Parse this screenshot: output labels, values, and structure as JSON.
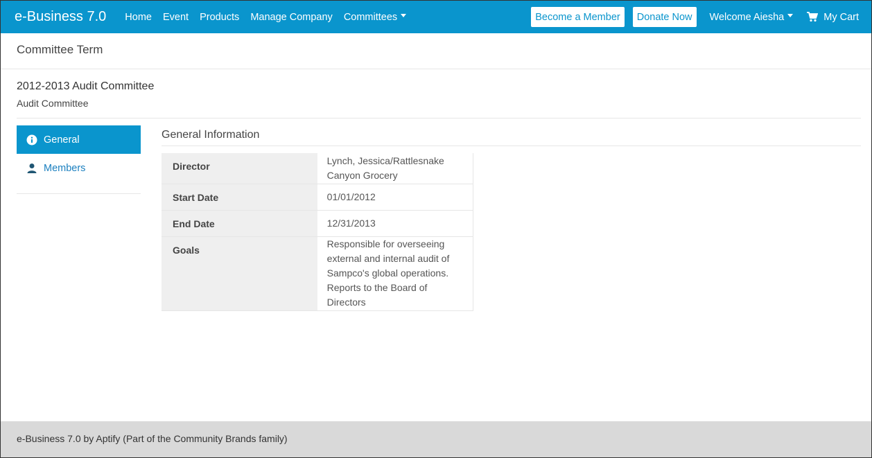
{
  "navbar": {
    "brand": "e-Business 7.0",
    "links": [
      "Home",
      "Event",
      "Products",
      "Manage Company",
      "Committees"
    ],
    "become_member": "Become a Member",
    "donate_now": "Donate Now",
    "welcome": "Welcome Aiesha",
    "cart": "My Cart",
    "color": "#0a95cd"
  },
  "page": {
    "title": "Committee Term"
  },
  "term": {
    "title": "2012-2013 Audit Committee",
    "subtitle": "Audit Committee"
  },
  "side_nav": {
    "general": "General",
    "members": "Members"
  },
  "general_info": {
    "title": "General Information",
    "rows": [
      {
        "label": "Director",
        "value": "Lynch, Jessica/Rattlesnake Canyon Grocery"
      },
      {
        "label": "Start Date",
        "value": "01/01/2012"
      },
      {
        "label": "End Date",
        "value": "12/31/2013"
      },
      {
        "label": "Goals",
        "value": "Responsible for overseeing external and internal audit of Sampco's global operations. Reports to the Board of Directors"
      }
    ]
  },
  "footer": {
    "text": "e-Business 7.0 by Aptify (Part of the Community Brands family)"
  }
}
